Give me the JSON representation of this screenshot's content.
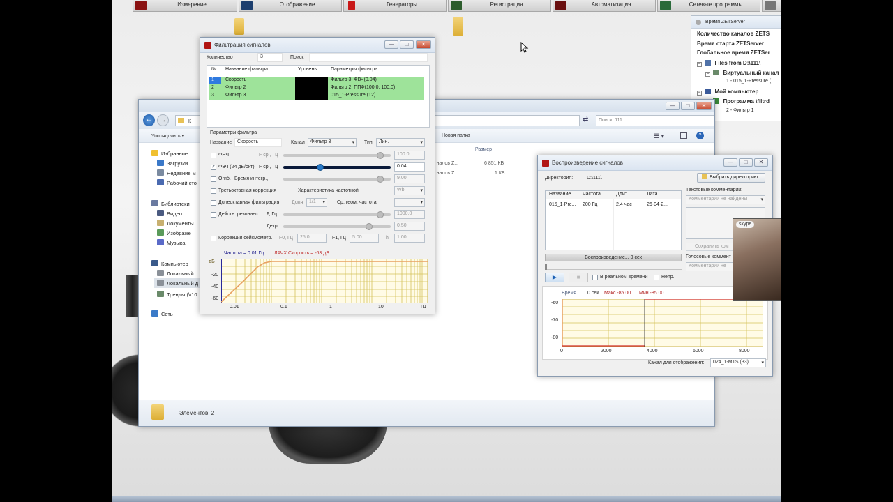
{
  "taskbar_top": [
    {
      "label": "Измерение"
    },
    {
      "label": "Отображение"
    },
    {
      "label": "Генераторы"
    },
    {
      "label": "Регистрация"
    },
    {
      "label": "Автоматизация"
    },
    {
      "label": "Сетевые программы"
    }
  ],
  "zet_panel": {
    "title": "Время ZETServer",
    "line1": "Количество каналов ZETS",
    "line2": "Время старта ZETServer",
    "line3": "Глобальное время ZETSer",
    "files_node": "Files from D:\\111\\",
    "virtual_node": "Виртуальный канал",
    "virtual_child": "1 - 015_1-Pressure (",
    "my_computer": "Мой компьютер",
    "program_node": "Программа \\filtrd",
    "program_child": "2 - Фильтр 1"
  },
  "filter_window": {
    "title": "Фильтрация сигналов",
    "count_label": "Количество",
    "count_value": "3",
    "search_label": "Поиск",
    "col_num": "№",
    "col_name": "Название фильтра",
    "col_level": "Уровень",
    "col_params": "Параметры фильтра",
    "rows": [
      {
        "num": "1",
        "name": "Скорость",
        "params": "Фильтр 3, ФВЧ(0.04)"
      },
      {
        "num": "2",
        "name": "Фильтр 2",
        "params": "Фильтр 2, ППФ(100.0, 100.0)"
      },
      {
        "num": "3",
        "name": "Фильтр 3",
        "params": "015_1-Pressure (12)"
      }
    ],
    "params_group": "Параметры фильтра",
    "name_label": "Название",
    "name_value": "Скорость",
    "channel_label": "Канал",
    "channel_value": "Фильтр 3",
    "type_label": "Тип",
    "type_value": "Лин.",
    "fnch_label": "ФНЧ",
    "fcut_label": "F ср., Гц",
    "fnch_value": "100.0",
    "fvch_label": "ФВЧ (24 дБ/окт)",
    "fvch_value": "0.04",
    "ogib_label": "Огиб.",
    "integ_label": "Время интегр.,",
    "integ_value": "9.00",
    "tertz_label": "Третьоктавная коррекция",
    "char_label": "Характеристика частотной",
    "char_value": "Wb",
    "doloct_label": "Долеоктавная фильтрация",
    "dolya_label": "Доля",
    "dolya_value": "1/1",
    "geom_label": "Ср. геом. частота,",
    "rez_label": "Действ. резонанс",
    "f_gc_label": "F, Гц",
    "rez_value": "1000.0",
    "dekr_label": "Декр.",
    "dekr_value": "0.50",
    "seis_label": "Коррекция сейсмометр.",
    "f0_label": "F0, Гц",
    "f0_value": "25.0",
    "f1_label": "F1, Гц",
    "f1_value": "5.00",
    "h_label": "h",
    "h_value": "1.00",
    "freq_readout": "Частота = 0.01 Гц",
    "achh_readout": "ЛАЧХ Скорость = -63 дБ",
    "y_unit": "дБ",
    "y_ticks": [
      "-20",
      "-40",
      "-60"
    ],
    "x_ticks": [
      "0.01",
      "0.1",
      "1",
      "10",
      "Гц"
    ]
  },
  "explorer": {
    "breadcrumb": "К",
    "search_placeholder": "Поиск: 111",
    "organize": "Упорядочить",
    "new_folder": "Новая папка",
    "col_size": "Размер",
    "files": [
      {
        "name": "игналов Z...",
        "size": "6 851 КБ"
      },
      {
        "name": "игналов Z...",
        "size": "1 КБ"
      }
    ],
    "favorites_header": "Избранное",
    "favorites": [
      "Загрузки",
      "Недавние м",
      "Рабочий сто"
    ],
    "libraries_header": "Библиотеки",
    "libraries": [
      "Видео",
      "Документы",
      "Изображе",
      "Музыка"
    ],
    "computer_header": "Компьютер",
    "computer": [
      "Локальный",
      "Локальный д",
      "Тренды (\\\\10"
    ],
    "network": "Сеть",
    "status": "Элементов: 2"
  },
  "playback_window": {
    "title": "Воспроизведение сигналов",
    "dir_label": "Директория:",
    "dir_value": "D:\\111\\",
    "choose_dir": "Выбрать директорию",
    "columns": [
      "Название",
      "Частота",
      "Длит.",
      "Дата"
    ],
    "row": {
      "name": "015_1-Pre...",
      "freq": "200 Гц",
      "dur": "2.4 час",
      "date": "26-04-2..."
    },
    "text_comments_label": "Текстовые комментарии:",
    "text_comments_value": "Комментарии не найдены",
    "save_comment": "Сохранить ком",
    "voice_comments_label": "Голосовые коммент",
    "voice_comments_value": "Комментарии не",
    "progress_label": "Воспроизведение... 0 сек",
    "realtime_label": "В реальном времени",
    "continuous_label": "Непр.",
    "time_label": "Время",
    "time_value": "0 сек",
    "max_label": "Макс -85.00",
    "min_label": "Мин -85.00",
    "y_ticks": [
      "-60",
      "-70",
      "-80"
    ],
    "x_ticks": [
      "0",
      "2000",
      "4000",
      "6000",
      "8000"
    ],
    "channel_label": "Канал для отображения:",
    "channel_value": "024_1-MTS (33)"
  },
  "skype": {
    "label": "skype"
  },
  "colors": {
    "row_green": "#9ee39a",
    "chart_bg": "#fffbe6",
    "chart_grid": "#d4c25a",
    "curve_orange": "#e8a060",
    "marker_red": "#d03030",
    "slider_blue": "#2a7ac8"
  }
}
